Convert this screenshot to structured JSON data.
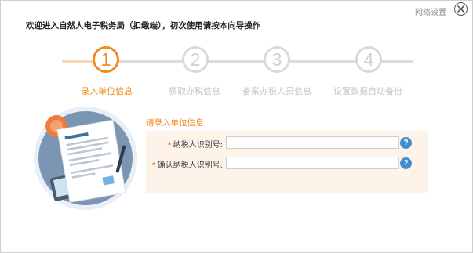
{
  "header": {
    "network_settings_label": "网络设置",
    "welcome_text": "欢迎进入自然人电子税务局（扣缴端），初次使用请按本向导操作"
  },
  "steps": [
    {
      "number": "1",
      "label": "录入单位信息",
      "active": true
    },
    {
      "number": "2",
      "label": "获取办税信息",
      "active": false
    },
    {
      "number": "3",
      "label": "备案办税人员信息",
      "active": false
    },
    {
      "number": "4",
      "label": "设置数据自动备份",
      "active": false
    }
  ],
  "form": {
    "title": "请录入单位信息",
    "fields": [
      {
        "label": "纳税人识别号:",
        "value": "",
        "placeholder": ""
      },
      {
        "label": "确认纳税人识别号:",
        "value": "",
        "placeholder": ""
      }
    ],
    "help_glyph": "?"
  },
  "colors": {
    "accent": "#f08b1e",
    "inactive": "#d9d9d9",
    "panel": "#fdf3e9",
    "help": "#3f8fcf"
  }
}
